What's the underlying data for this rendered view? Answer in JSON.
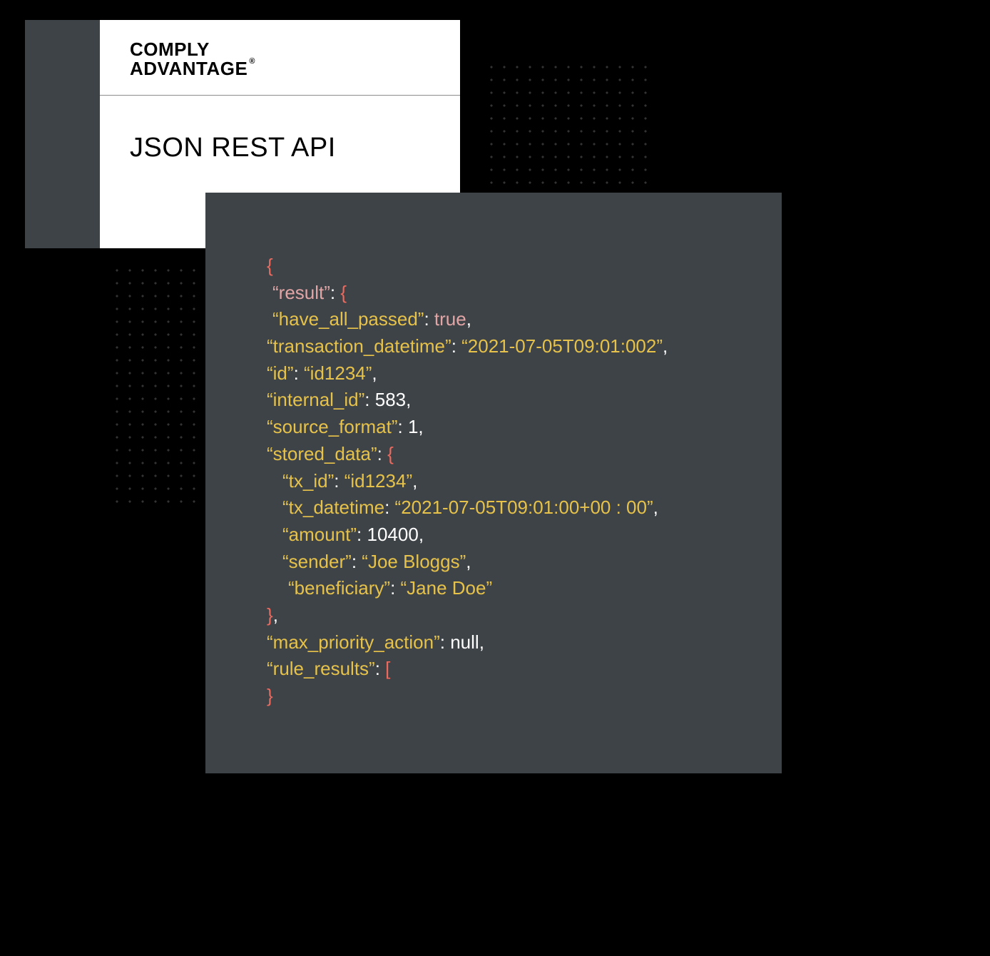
{
  "brand": {
    "line1": "COMPLY",
    "line2": "ADVANTAGE",
    "registered": "®"
  },
  "title": "JSON REST API",
  "code": {
    "open_brace": "{",
    "result_key": "“result”",
    "result_brace": "{",
    "have_all_passed_key": "“have_all_passed”",
    "have_all_passed_val": "true",
    "transaction_datetime_key": "“transaction_datetime”",
    "transaction_datetime_val": "“2021-07-05T09:01:002”",
    "id_key": "“id”",
    "id_val": "“id1234”",
    "internal_id_key": "“internal_id”",
    "internal_id_val": "583",
    "source_format_key": "“source_format”",
    "source_format_val": "1",
    "stored_data_key": "“stored_data”",
    "stored_data_brace": "{",
    "tx_id_key": "“tx_id”",
    "tx_id_val": "“id1234”",
    "tx_datetime_key": "“tx_datetime",
    "tx_datetime_val": "“2021-07-05T09:01:00+00 : 00”",
    "amount_key": "“amount”",
    "amount_val": "10400",
    "sender_key": "“sender”",
    "sender_val": "“Joe Bloggs”",
    "beneficiary_key": "“beneficiary”",
    "beneficiary_val": "“Jane Doe”",
    "close_brace_stored": "}",
    "max_priority_action_key": "“max_priority_action”",
    "max_priority_action_val": "null",
    "rule_results_key": "“rule_results”",
    "rule_results_bracket": "[",
    "final_brace": "}"
  }
}
